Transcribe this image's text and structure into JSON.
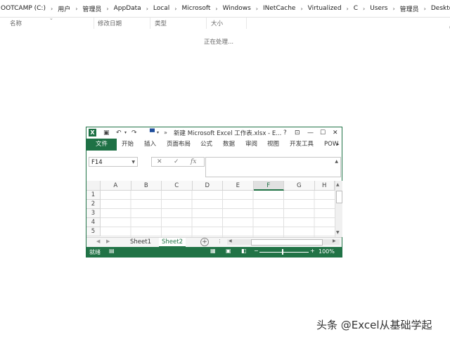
{
  "explorer": {
    "breadcrumb": [
      "OOTCAMP (C:)",
      "用户",
      "管理员",
      "AppData",
      "Local",
      "Microsoft",
      "Windows",
      "INetCache",
      "Virtualized",
      "C",
      "Users",
      "管理员",
      "Desktop"
    ],
    "columns": {
      "name": "名称",
      "modified": "修改日期",
      "type": "类型",
      "size": "大小"
    },
    "status_text": "正在处理...",
    "edge_char": "("
  },
  "excel": {
    "title": "新建 Microsoft Excel 工作表.xlsx - E...",
    "window_buttons": {
      "help": "?",
      "restore_ribbon": "⊡",
      "minimize": "—",
      "maximize": "☐",
      "close": "✕"
    },
    "ribbon_tabs": [
      "文件",
      "开始",
      "插入",
      "页面布局",
      "公式",
      "数据",
      "审阅",
      "视图",
      "开发工具",
      "POW"
    ],
    "name_box": "F14",
    "fx": "fx",
    "column_headers": [
      "A",
      "B",
      "C",
      "D",
      "E",
      "F",
      "G",
      "H"
    ],
    "selected_column": "F",
    "row_headers": [
      "1",
      "2",
      "3",
      "4",
      "5"
    ],
    "sheets": [
      "Sheet1",
      "Sheet2"
    ],
    "active_sheet": "Sheet2",
    "status": {
      "ready": "就绪",
      "zoom": "100%",
      "zoom_level": 1.0
    },
    "colors": {
      "accent": "#217346"
    }
  },
  "watermark": "头条 @Excel从基础学起"
}
